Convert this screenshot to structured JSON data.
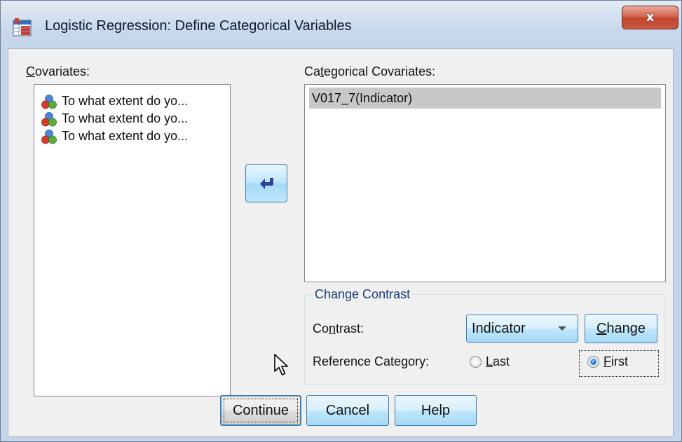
{
  "window": {
    "title": "Logistic Regression: Define Categorical Variables",
    "close_glyph": "x",
    "app_icon": "spss-dialog-icon"
  },
  "covariates": {
    "label_u": "C",
    "label_rest": "ovariates:",
    "items": [
      {
        "icon": "scale-variable-icon",
        "text": "To what extent do yo..."
      },
      {
        "icon": "scale-variable-icon",
        "text": "To what extent do yo..."
      },
      {
        "icon": "scale-variable-icon",
        "text": "To what extent do yo..."
      }
    ]
  },
  "move_button": {
    "icon": "arrow-left-icon"
  },
  "categorical": {
    "label_pre": "Ca",
    "label_u": "t",
    "label_rest": "egorical Covariates:",
    "items": [
      "V017_7(Indicator)"
    ],
    "selected_index": 0
  },
  "change_contrast": {
    "title": "Change Contrast",
    "contrast_label_pre": "Co",
    "contrast_label_u": "n",
    "contrast_label_rest": "trast:",
    "contrast_value": "Indicator",
    "change_button_u": "C",
    "change_button_rest": "hange",
    "reference_label": "Reference Category:",
    "last_label_u": "L",
    "last_label_rest": "ast",
    "first_label_u": "F",
    "first_label_rest": "irst",
    "selected": "First"
  },
  "footer": {
    "continue_label": "Continue",
    "cancel_label": "Cancel",
    "help_label": "Help"
  },
  "colors": {
    "accent": "#3c7fb1",
    "group_title": "#1c3d7e",
    "close_red": "#c34630",
    "selection": "#c8c8c8"
  }
}
